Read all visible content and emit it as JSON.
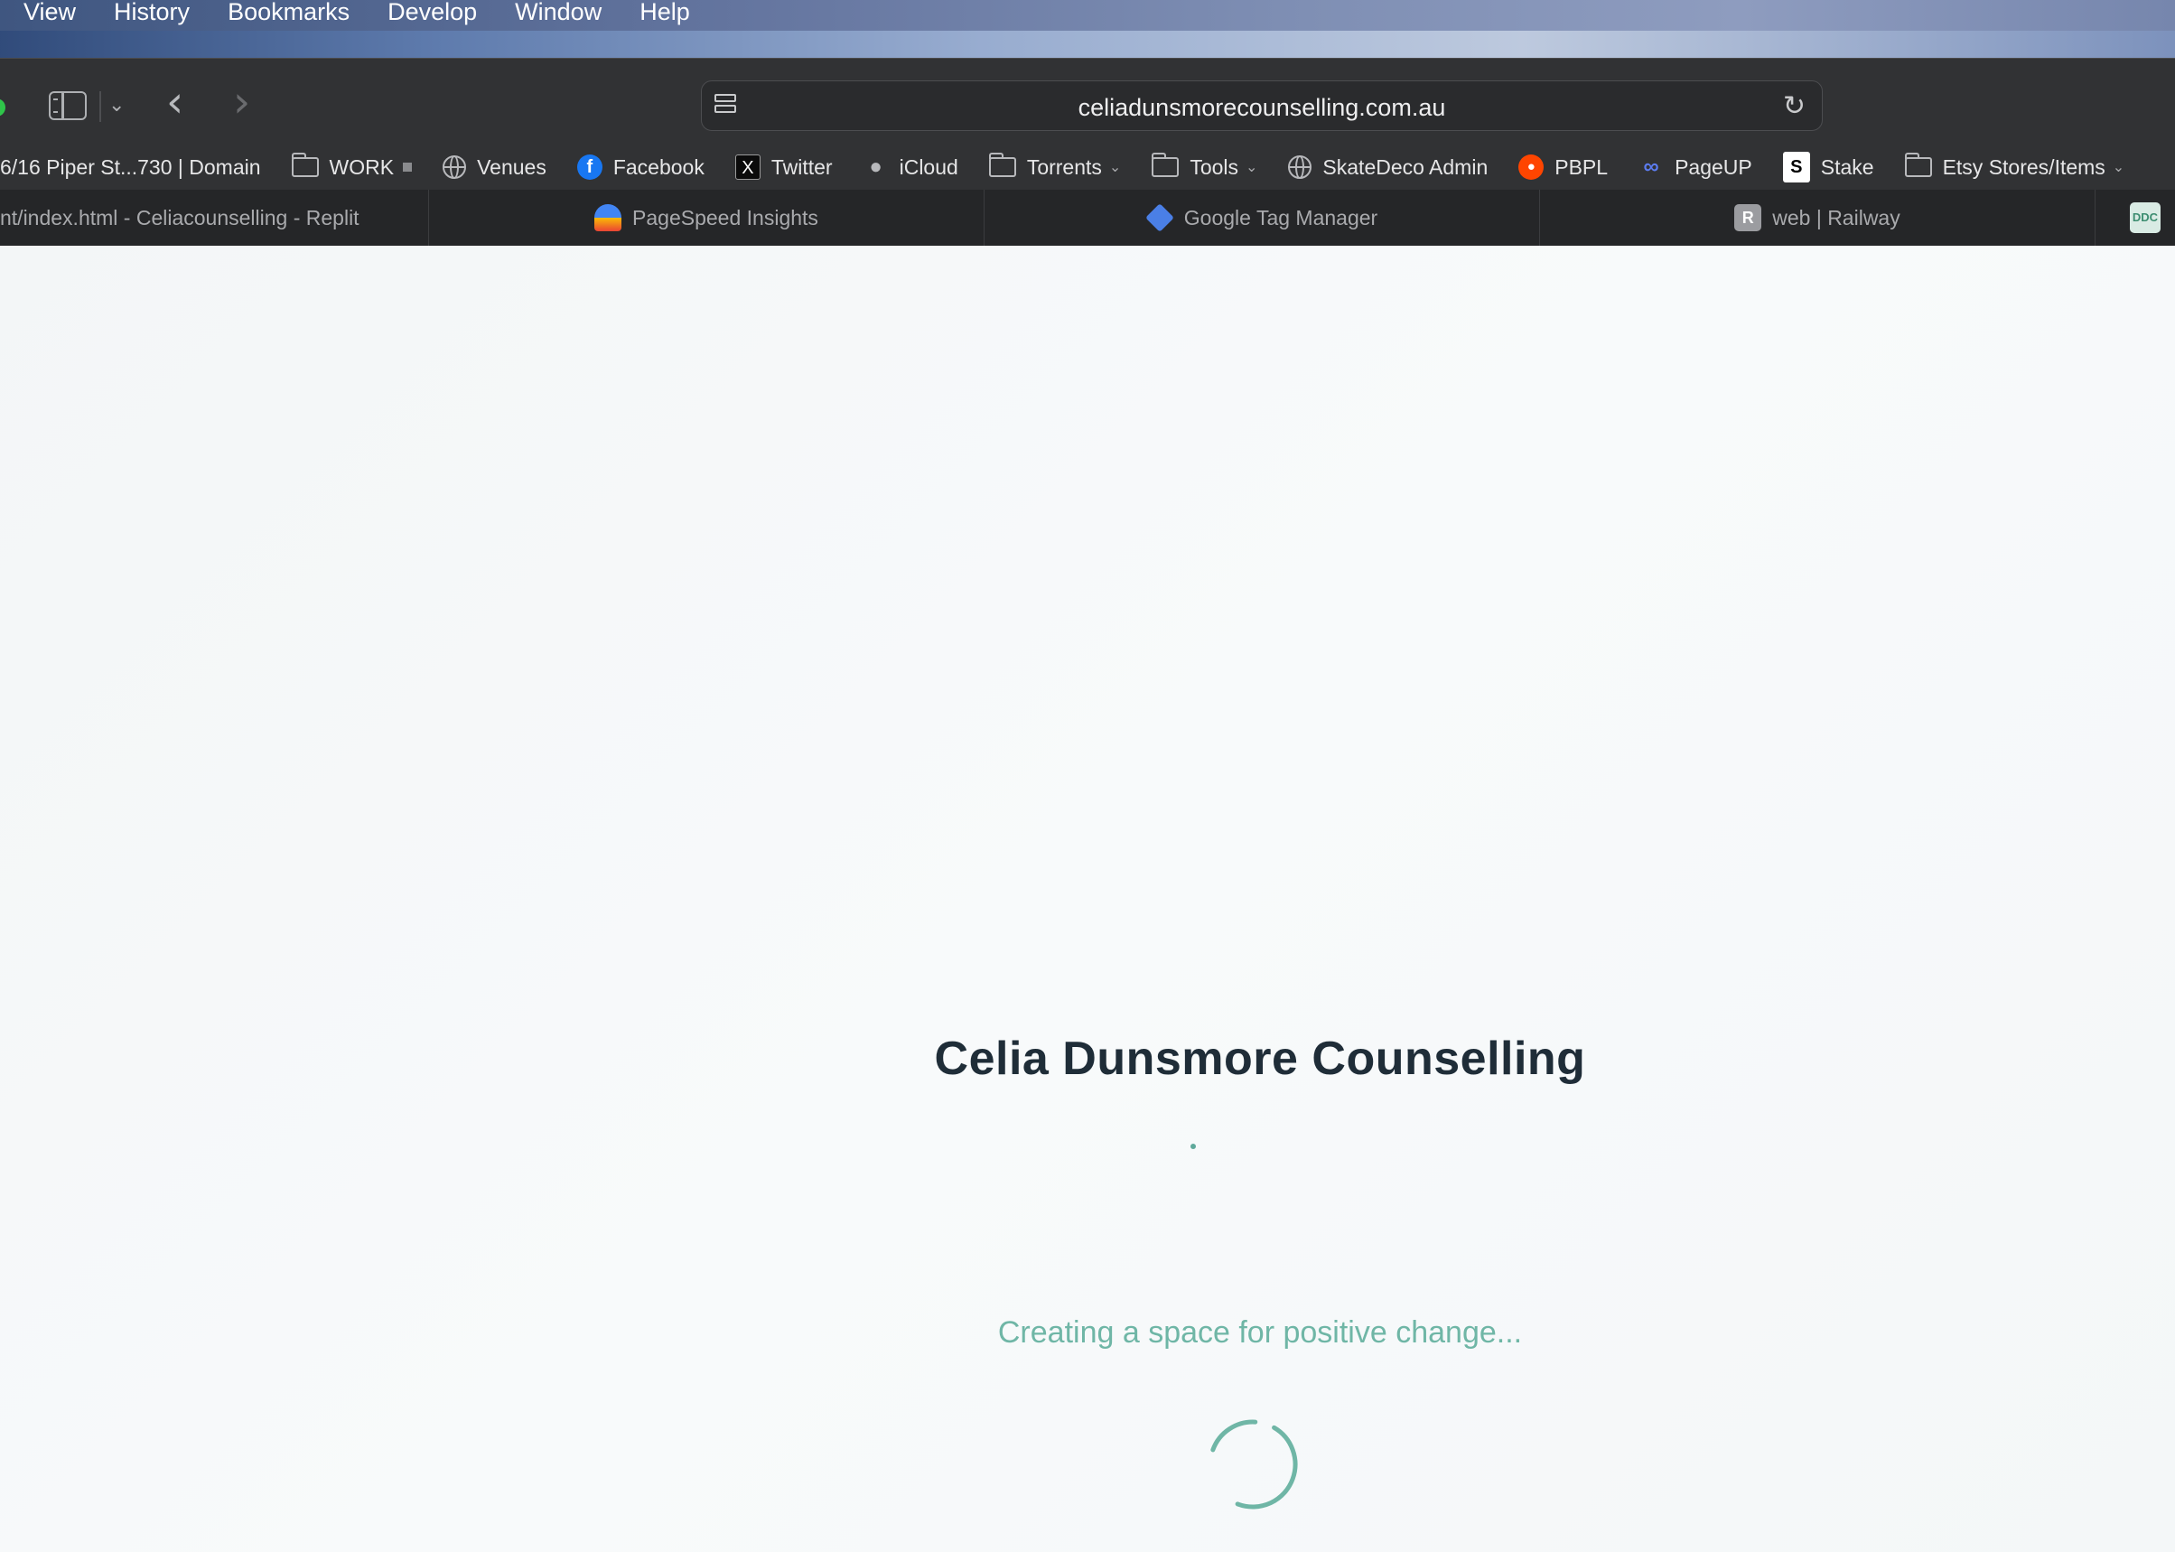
{
  "menubar": {
    "items": [
      "View",
      "History",
      "Bookmarks",
      "Develop",
      "Window",
      "Help"
    ]
  },
  "toolbar": {
    "url": "celiadunsmorecounselling.com.au"
  },
  "bookmarks": {
    "items": [
      {
        "label": "6/16 Piper St...730 | Domain",
        "icon": "none"
      },
      {
        "label": "WORK",
        "icon": "folder-icon"
      },
      {
        "label": "Venues",
        "icon": "globe-icon"
      },
      {
        "label": "Facebook",
        "icon": "facebook-icon"
      },
      {
        "label": "Twitter",
        "icon": "x-icon"
      },
      {
        "label": "iCloud",
        "icon": "apple-icon"
      },
      {
        "label": "Torrents",
        "icon": "folder-icon"
      },
      {
        "label": "Tools",
        "icon": "folder-icon"
      },
      {
        "label": "SkateDeco Admin",
        "icon": "globe-icon"
      },
      {
        "label": "PBPL",
        "icon": "reddit-icon"
      },
      {
        "label": "PageUP",
        "icon": "link-icon"
      },
      {
        "label": "Stake",
        "icon": "stake-icon"
      },
      {
        "label": "Etsy Stores/Items",
        "icon": "folder-icon"
      }
    ]
  },
  "tabs": [
    {
      "label": "nt/index.html - Celiacounselling - Replit"
    },
    {
      "label": "PageSpeed Insights"
    },
    {
      "label": "Google Tag Manager"
    },
    {
      "label": "web | Railway",
      "favicon_letter": "R"
    },
    {
      "label": "",
      "favicon_letter": "DDC"
    }
  ],
  "page": {
    "title": "Celia Dunsmore Counselling",
    "tagline": "Creating a space for positive change...",
    "accent_color": "#6fb6a6"
  }
}
